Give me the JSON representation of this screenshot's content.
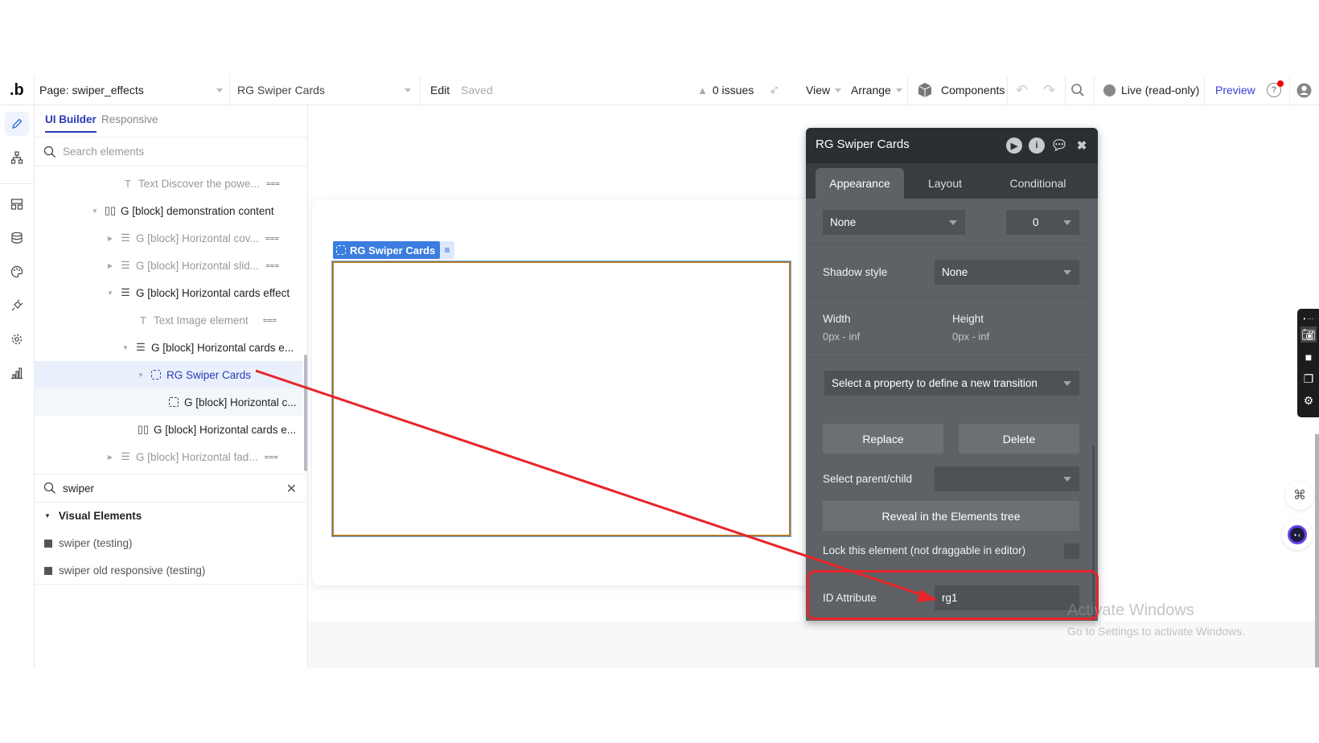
{
  "topbar": {
    "logo": ".b",
    "page_selector": "Page: swiper_effects",
    "element_selector": "RG Swiper Cards",
    "edit_label": "Edit",
    "saved_status": "Saved",
    "issues": "0 issues",
    "view_menu": "View",
    "arrange_menu": "Arrange",
    "components": "Components",
    "live_status": "Live (read-only)",
    "preview": "Preview"
  },
  "rail": {
    "items": [
      "design",
      "workflow",
      "styles-layout",
      "data",
      "styles",
      "plugins",
      "settings",
      "logs"
    ]
  },
  "elements_panel": {
    "tabs": [
      {
        "label": "UI Builder",
        "active": true
      },
      {
        "label": "Responsive",
        "active": false
      }
    ],
    "search_placeholder": "Search elements",
    "tree": [
      {
        "label": "Text Discover the powe...",
        "icon": "text",
        "hidden": true,
        "dim": true
      },
      {
        "label": "G [block] demonstration content",
        "icon": "column-group",
        "expanded": true
      },
      {
        "label": "G [block] Horizontal cov...",
        "icon": "row-group",
        "hidden": true,
        "dim": true,
        "collapsed": true
      },
      {
        "label": "G [block] Horizontal slid...",
        "icon": "row-group",
        "hidden": true,
        "dim": true,
        "collapsed": true
      },
      {
        "label": "G [block] Horizontal cards effect",
        "icon": "row-group",
        "expanded": true
      },
      {
        "label": "Text Image element",
        "icon": "text",
        "hidden": true,
        "dim": true
      },
      {
        "label": "G [block] Horizontal cards e...",
        "icon": "row-group",
        "expanded": true
      },
      {
        "label": "RG Swiper Cards",
        "icon": "repeating-group",
        "expanded": true,
        "selected": true
      },
      {
        "label": "G [block] Horizontal c...",
        "icon": "dashed-group"
      },
      {
        "label": "G [block] Horizontal cards e...",
        "icon": "column-group"
      },
      {
        "label": "G [block] Horizontal fad...",
        "icon": "row-group",
        "hidden": true,
        "dim": true,
        "collapsed": true
      }
    ],
    "filter_value": "swiper",
    "group_heading": "Visual Elements",
    "visual_elements": [
      "swiper (testing)",
      "swiper old responsive (testing)"
    ]
  },
  "canvas": {
    "selected_tag": "RG Swiper Cards"
  },
  "property_editor": {
    "title": "RG Swiper Cards",
    "tabs": [
      {
        "label": "Appearance",
        "active": true
      },
      {
        "label": "Layout",
        "active": false
      },
      {
        "label": "Conditional",
        "active": false
      }
    ],
    "border_style": "None",
    "border_width": "0",
    "shadow_label": "Shadow style",
    "shadow_value": "None",
    "width_label": "Width",
    "width_value": "0px - inf",
    "height_label": "Height",
    "height_value": "0px - inf",
    "transition_placeholder": "Select a property to define a new transition",
    "replace_button": "Replace",
    "delete_button": "Delete",
    "parent_child_label": "Select parent/child",
    "parent_child_value": "",
    "reveal_button": "Reveal in the Elements tree",
    "lock_label": "Lock this element (not draggable in editor)",
    "lock_checked": false,
    "id_label": "ID Attribute",
    "id_value": "rg1"
  },
  "annotation": {
    "arrow_color": "#e8242a",
    "highlight_color": "#e8242a"
  },
  "watermark": {
    "title": "Activate Windows",
    "subtitle": "Go to Settings to activate Windows."
  }
}
